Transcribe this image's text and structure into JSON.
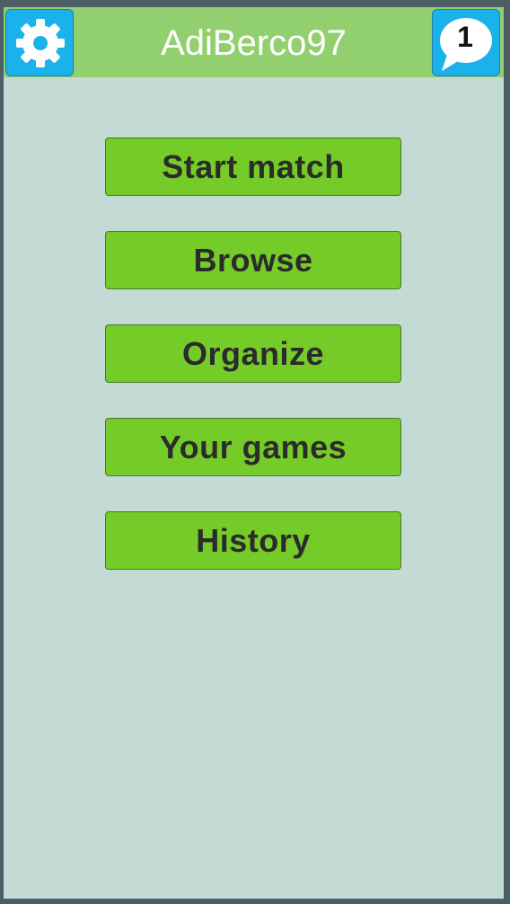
{
  "header": {
    "username": "AdiBerco97",
    "settings_icon": "gear-icon",
    "messages_icon": "speech-bubble-icon",
    "unread_count": "1"
  },
  "menu": {
    "items": [
      {
        "label": "Start match"
      },
      {
        "label": "Browse"
      },
      {
        "label": "Organize"
      },
      {
        "label": "Your games"
      },
      {
        "label": "History"
      }
    ]
  },
  "colors": {
    "frame": "#4c5f66",
    "background": "#c3dad5",
    "header": "#92cf6e",
    "icon_button": "#1bb2ec",
    "menu_button": "#75cb27",
    "menu_text": "#2b2b2b"
  }
}
